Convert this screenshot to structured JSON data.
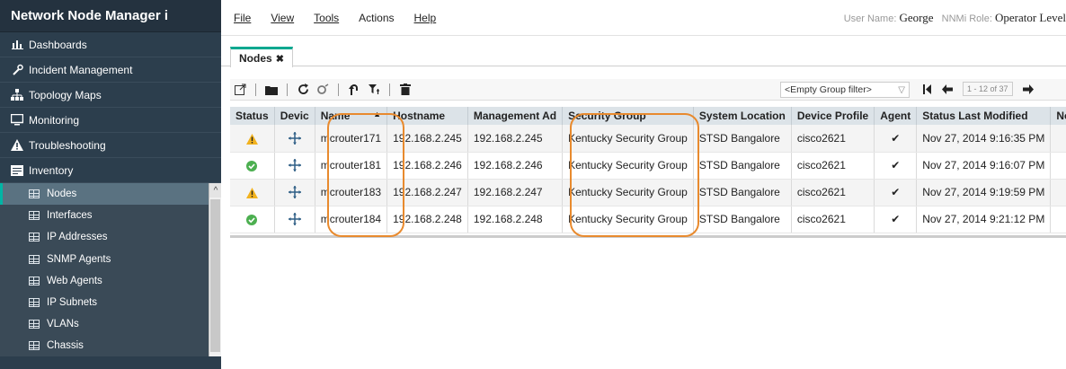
{
  "app": {
    "title": "Network Node Manager i"
  },
  "sidebar": {
    "items": [
      {
        "label": "Dashboards",
        "icon": "bar-chart-icon"
      },
      {
        "label": "Incident Management",
        "icon": "wrench-icon"
      },
      {
        "label": "Topology Maps",
        "icon": "topology-icon"
      },
      {
        "label": "Monitoring",
        "icon": "monitor-icon"
      },
      {
        "label": "Troubleshooting",
        "icon": "warning-triangle-icon"
      },
      {
        "label": "Inventory",
        "icon": "inventory-icon"
      }
    ],
    "inventory_items": [
      {
        "label": "Nodes",
        "active": true
      },
      {
        "label": "Interfaces"
      },
      {
        "label": "IP Addresses"
      },
      {
        "label": "SNMP Agents"
      },
      {
        "label": "Web Agents"
      },
      {
        "label": "IP Subnets"
      },
      {
        "label": "VLANs"
      },
      {
        "label": "Chassis"
      }
    ]
  },
  "menubar": {
    "file": "File",
    "view": "View",
    "tools": "Tools",
    "actions": "Actions",
    "help": "Help"
  },
  "user": {
    "name_label": "User Name:",
    "name": "George",
    "role_label": "NNMi Role:",
    "role": "Operator Level"
  },
  "tab": {
    "label": "Nodes",
    "close": "✖"
  },
  "toolbar": {
    "group_filter": "<Empty Group filter>",
    "page_range": "1 - 12 of 37"
  },
  "table": {
    "headers": [
      "Status",
      "Devic",
      "Name",
      "Hostname",
      "Management Ad",
      "Security Group",
      "System Location",
      "Device Profile",
      "Agent",
      "Status Last Modified",
      "No"
    ],
    "rows": [
      {
        "status": "warning",
        "name": "mcrouter171",
        "hostname": "192.168.2.245",
        "mgmt": "192.168.2.245",
        "security": "Kentucky Security Group",
        "location": "STSD Bangalore",
        "profile": "cisco2621",
        "agent": "✔",
        "modified": "Nov 27, 2014 9:16:35 PM"
      },
      {
        "status": "normal",
        "name": "mcrouter181",
        "hostname": "192.168.2.246",
        "mgmt": "192.168.2.246",
        "security": "Kentucky Security Group",
        "location": "STSD Bangalore",
        "profile": "cisco2621",
        "agent": "✔",
        "modified": "Nov 27, 2014 9:16:07 PM"
      },
      {
        "status": "warning",
        "name": "mcrouter183",
        "hostname": "192.168.2.247",
        "mgmt": "192.168.2.247",
        "security": "Kentucky Security Group",
        "location": "STSD Bangalore",
        "profile": "cisco2621",
        "agent": "✔",
        "modified": "Nov 27, 2014 9:19:59 PM"
      },
      {
        "status": "normal",
        "name": "mcrouter184",
        "hostname": "192.168.2.248",
        "mgmt": "192.168.2.248",
        "security": "Kentucky Security Group",
        "location": "STSD Bangalore",
        "profile": "cisco2621",
        "agent": "✔",
        "modified": "Nov 27, 2014 9:21:12 PM"
      }
    ]
  },
  "colors": {
    "sidebar_bg": "#2c3e4d",
    "active_accent": "#00b5a5",
    "highlight_orange": "#e88a2e",
    "warning_yellow": "#f2b21e",
    "normal_green": "#4caf50"
  }
}
